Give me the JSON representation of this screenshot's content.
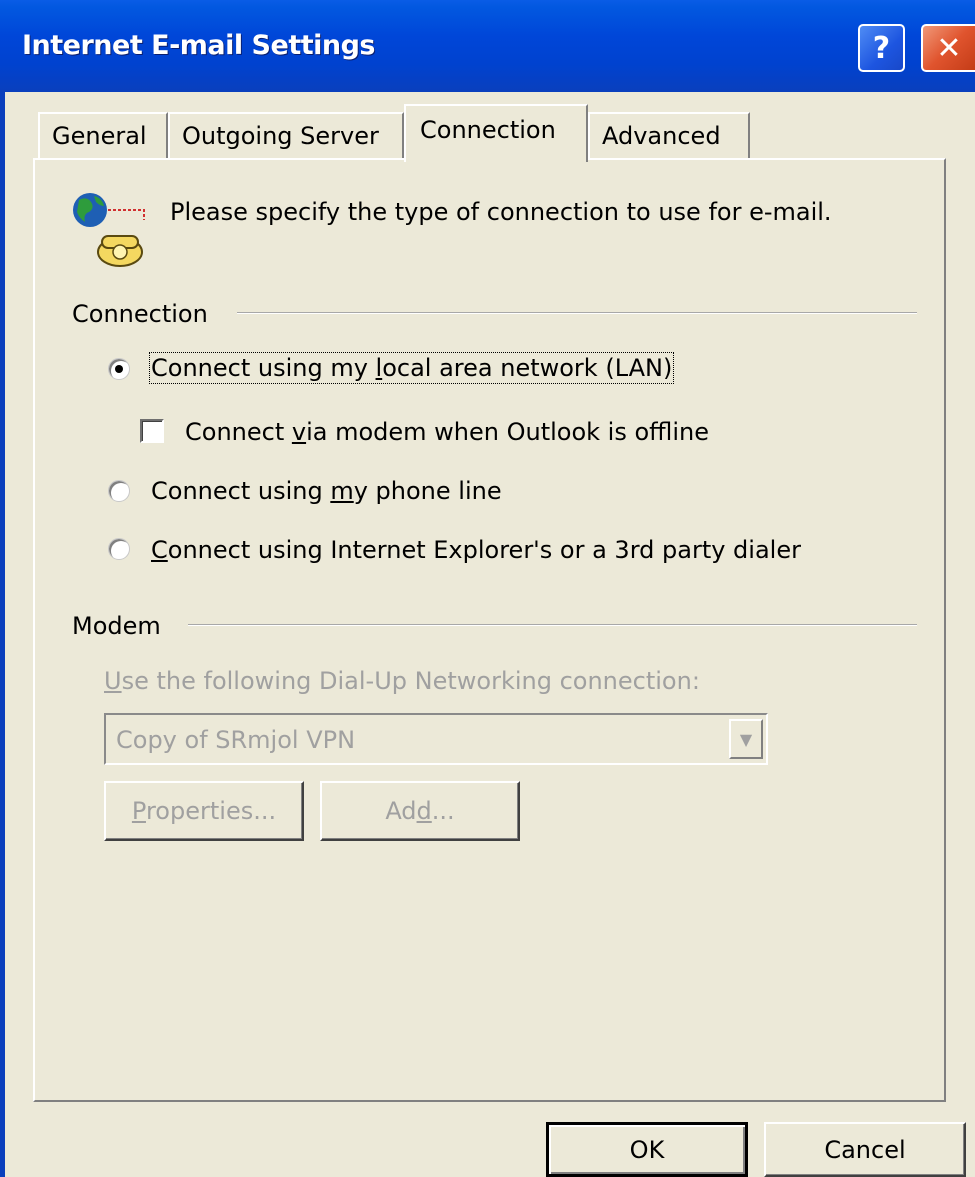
{
  "window": {
    "title": "Internet E-mail Settings",
    "help_label": "?",
    "close_label": "✕"
  },
  "tabs": [
    {
      "label": "General"
    },
    {
      "label": "Outgoing Server"
    },
    {
      "label": "Connection",
      "active": true
    },
    {
      "label": "Advanced"
    }
  ],
  "header": {
    "text": "Please specify the type of connection to use for e-mail."
  },
  "connection_group": {
    "label": "Connection",
    "options": {
      "lan_pre": "Connect using my ",
      "lan_key": "l",
      "lan_post": "ocal area network (LAN)",
      "modem_pre": "Connect ",
      "modem_key": "v",
      "modem_post": "ia modem when Outlook is offline",
      "phone_pre": "Connect using ",
      "phone_key": "m",
      "phone_post": "y phone line",
      "dialer_key": "C",
      "dialer_post": "onnect using Internet Explorer's or a 3rd party dialer"
    },
    "selected": "lan",
    "modem_offline_checked": false
  },
  "modem_group": {
    "label": "Modem",
    "dialup_key": "U",
    "dialup_post": "se the following Dial-Up Networking connection:",
    "selected_connection": "Copy of SRmjol VPN",
    "properties_key": "P",
    "properties_post": "roperties...",
    "add_pre": "Ad",
    "add_key": "d",
    "add_post": "...",
    "enabled": false
  },
  "footer": {
    "ok_label": "OK",
    "cancel_label": "Cancel"
  },
  "colors": {
    "titlebar": "#0046d8",
    "dialog_bg": "#ece9d8",
    "disabled_text": "#a0a0a0"
  }
}
